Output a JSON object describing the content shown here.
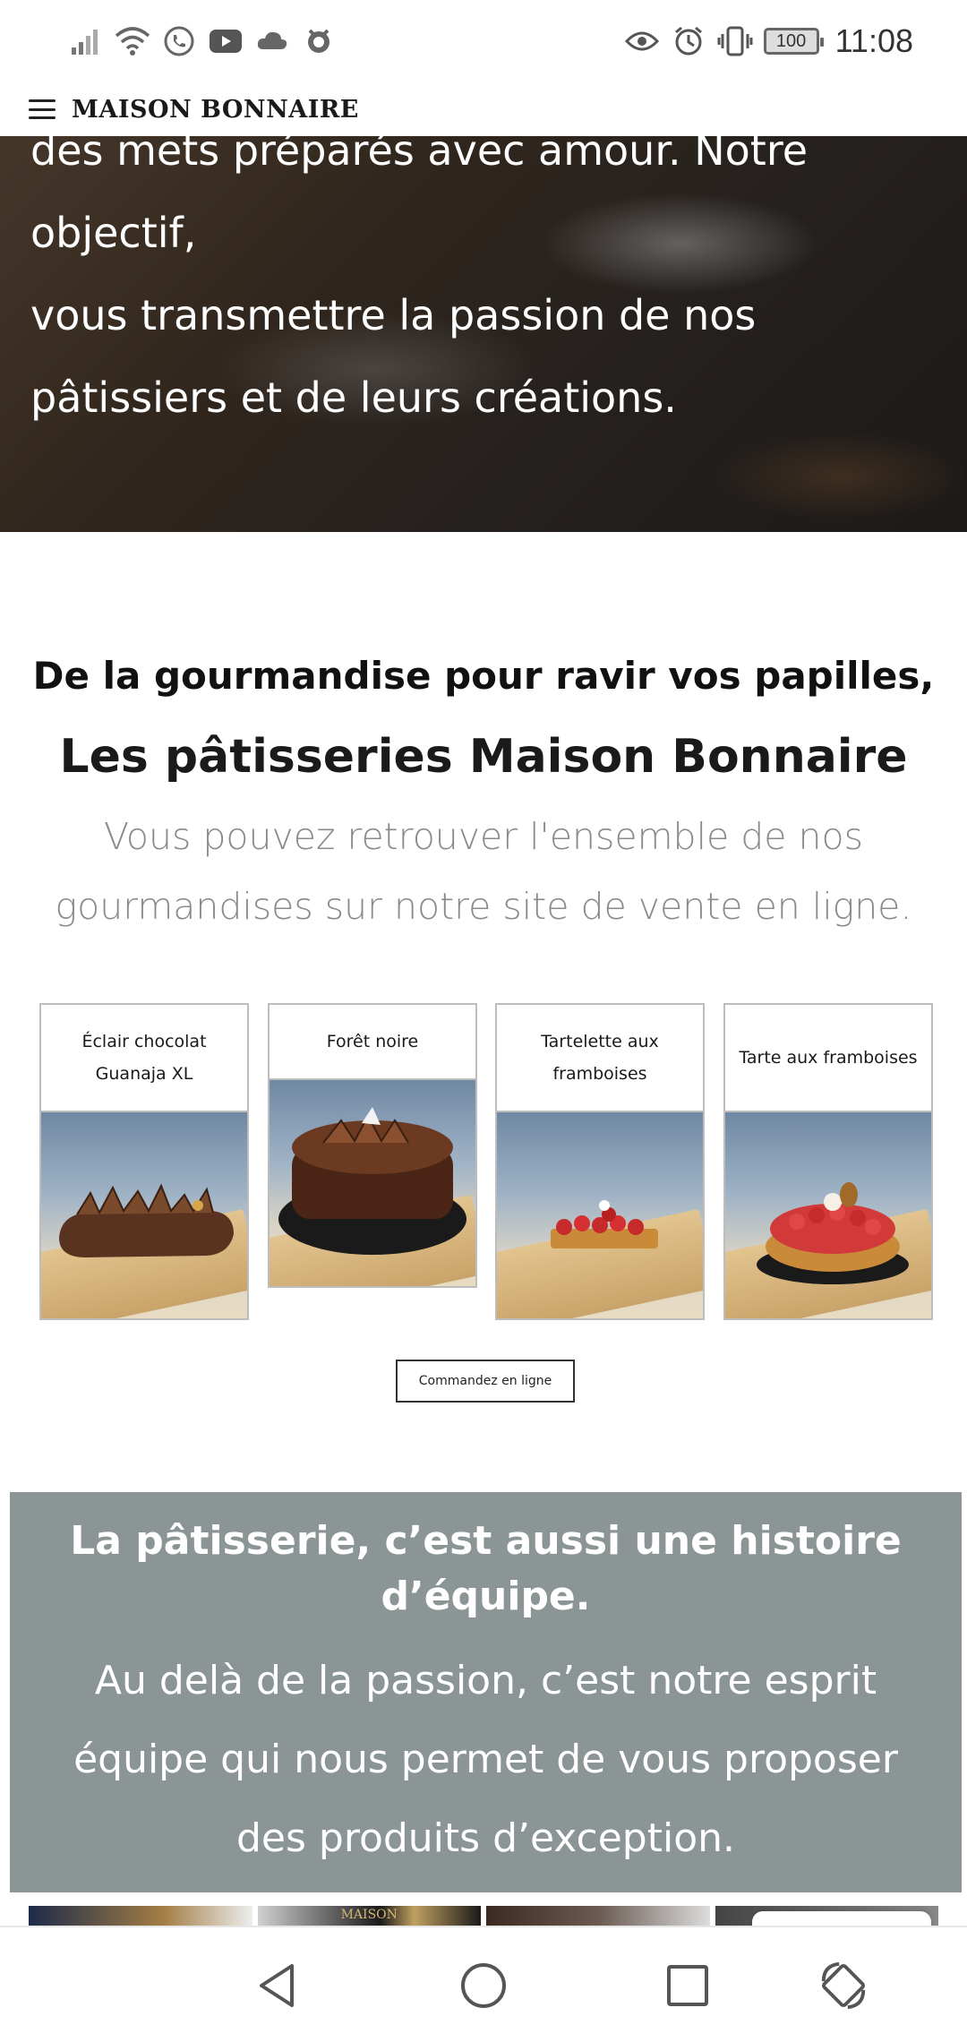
{
  "status_bar": {
    "time": "11:08",
    "battery": "100",
    "left_icons": [
      "signal-icon",
      "wifi-icon",
      "phone-icon",
      "youtube-icon",
      "weather-icon",
      "github-icon"
    ],
    "right_icons": [
      "eye-icon",
      "alarm-icon",
      "vibrate-icon",
      "battery-icon"
    ]
  },
  "header": {
    "brand": "MAISON BONNAIRE"
  },
  "hero": {
    "lines": [
      "des mets préparés avec amour. Notre",
      "objectif,",
      "vous transmettre la passion de nos",
      "pâtissiers et de leurs créations."
    ]
  },
  "intro": {
    "title": "De la gourmandise pour ravir vos papilles,",
    "subtitle": "Les pâtisseries Maison Bonnaire",
    "text": "Vous pouvez retrouver l'ensemble de nos gourmandises sur notre site de vente en ligne."
  },
  "products": [
    {
      "name": "Éclair chocolat Guanaja XL"
    },
    {
      "name": "Forêt noire"
    },
    {
      "name": "Tartelette aux framboises"
    },
    {
      "name": "Tarte aux framboises"
    }
  ],
  "order_button": "Commandez en ligne",
  "team": {
    "title": "La pâtisserie, c’est aussi une histoire d’équipe.",
    "text": "Au delà de la passion, c’est notre esprit équipe qui nous permet de vous proposer des produits d’exception."
  },
  "gallery": {
    "visible_label": "MAISON"
  },
  "colors": {
    "team_bg": "#8b9595",
    "order_border": "#333333"
  }
}
